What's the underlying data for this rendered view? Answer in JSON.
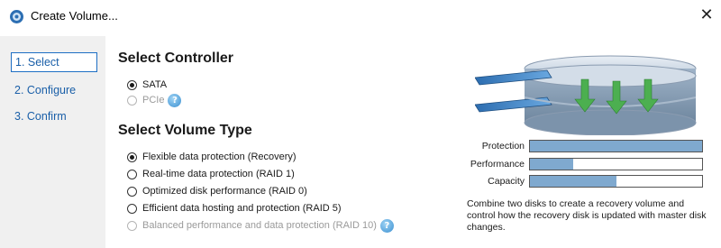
{
  "window": {
    "title": "Create Volume...",
    "close_glyph": "✕",
    "icon": "storage-app-icon"
  },
  "steps": [
    {
      "label": "1. Select",
      "active": true
    },
    {
      "label": "2. Configure",
      "active": false
    },
    {
      "label": "3. Confirm",
      "active": false
    }
  ],
  "controller": {
    "heading": "Select Controller",
    "options": [
      {
        "label": "SATA",
        "checked": true,
        "enabled": true
      },
      {
        "label": "PCIe",
        "checked": false,
        "enabled": false,
        "help": "?"
      }
    ]
  },
  "volume_type": {
    "heading": "Select Volume Type",
    "options": [
      {
        "label": "Flexible data protection (Recovery)",
        "checked": true,
        "enabled": true
      },
      {
        "label": "Real-time data protection (RAID 1)",
        "checked": false,
        "enabled": true
      },
      {
        "label": "Optimized disk performance (RAID 0)",
        "checked": false,
        "enabled": true
      },
      {
        "label": "Efficient data hosting and protection (RAID 5)",
        "checked": false,
        "enabled": true
      },
      {
        "label": "Balanced performance and data protection (RAID 10)",
        "checked": false,
        "enabled": false,
        "help": "?"
      }
    ]
  },
  "metrics": [
    {
      "label": "Protection",
      "value": 1.0
    },
    {
      "label": "Performance",
      "value": 0.25
    },
    {
      "label": "Capacity",
      "value": 0.5
    }
  ],
  "description": "Combine two disks to create a recovery volume and control how the recovery disk is updated with master disk changes.",
  "colors": {
    "accent": "#1e6fc4",
    "bar_fill": "#7fa9cf",
    "sidebar_bg": "#f0f0f0",
    "arrow_green": "#4caf50"
  }
}
